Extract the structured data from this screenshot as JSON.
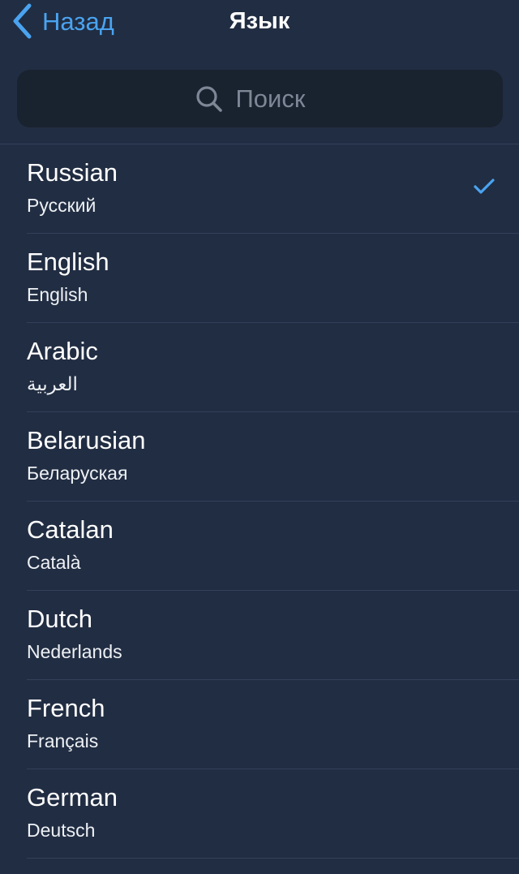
{
  "nav": {
    "back_label": "Назад",
    "title": "Язык"
  },
  "search": {
    "placeholder": "Поиск",
    "value": ""
  },
  "languages": [
    {
      "name": "Russian",
      "native": "Русский",
      "selected": true
    },
    {
      "name": "English",
      "native": "English",
      "selected": false
    },
    {
      "name": "Arabic",
      "native": "العربية",
      "selected": false
    },
    {
      "name": "Belarusian",
      "native": "Беларуская",
      "selected": false
    },
    {
      "name": "Catalan",
      "native": "Català",
      "selected": false
    },
    {
      "name": "Dutch",
      "native": "Nederlands",
      "selected": false
    },
    {
      "name": "French",
      "native": "Français",
      "selected": false
    },
    {
      "name": "German",
      "native": "Deutsch",
      "selected": false
    }
  ],
  "icons": {
    "back": "chevron-left-icon",
    "search": "search-icon",
    "selected": "checkmark-icon"
  },
  "colors": {
    "background": "#212d42",
    "accent": "#4aa3f0",
    "search_field": "#19222f",
    "divider": "#34405a",
    "placeholder": "#7d8796"
  }
}
